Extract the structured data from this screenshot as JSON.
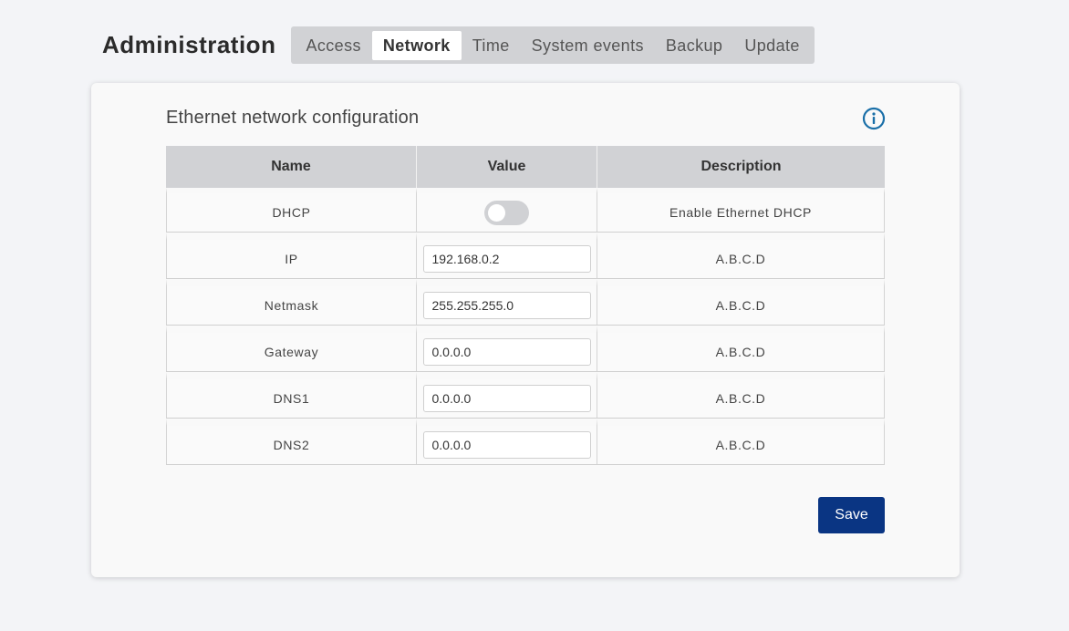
{
  "header": {
    "title": "Administration",
    "tabs": [
      {
        "label": "Access",
        "active": false
      },
      {
        "label": "Network",
        "active": true
      },
      {
        "label": "Time",
        "active": false
      },
      {
        "label": "System events",
        "active": false
      },
      {
        "label": "Backup",
        "active": false
      },
      {
        "label": "Update",
        "active": false
      }
    ]
  },
  "section": {
    "title": "Ethernet network configuration",
    "info_icon": "info-circle-icon",
    "info_color": "#1a6fa8"
  },
  "table": {
    "columns": [
      "Name",
      "Value",
      "Description"
    ],
    "rows": [
      {
        "name": "DHCP",
        "type": "toggle",
        "value": false,
        "description": "Enable Ethernet DHCP"
      },
      {
        "name": "IP",
        "type": "input",
        "value": "192.168.0.2",
        "description": "A.B.C.D"
      },
      {
        "name": "Netmask",
        "type": "input",
        "value": "255.255.255.0",
        "description": "A.B.C.D"
      },
      {
        "name": "Gateway",
        "type": "input",
        "value": "0.0.0.0",
        "description": "A.B.C.D"
      },
      {
        "name": "DNS1",
        "type": "input",
        "value": "0.0.0.0",
        "description": "A.B.C.D"
      },
      {
        "name": "DNS2",
        "type": "input",
        "value": "0.0.0.0",
        "description": "A.B.C.D"
      }
    ]
  },
  "actions": {
    "save_label": "Save",
    "save_color": "#0a3583"
  }
}
